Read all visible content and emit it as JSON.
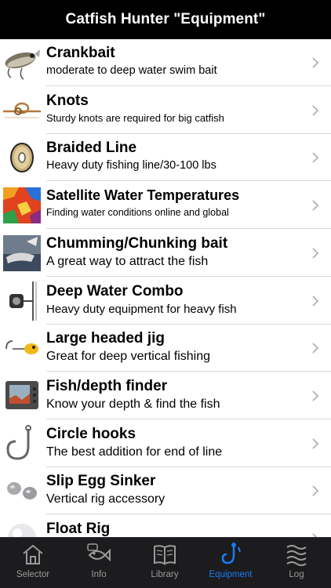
{
  "app": {
    "title": "Catfish Hunter \"Equipment\""
  },
  "list": {
    "items": [
      {
        "title": "Crankbait",
        "subtitle": "moderate to deep water swim bait",
        "icon": "crankbait-thumbnail"
      },
      {
        "title": "Knots",
        "subtitle": "Sturdy knots are required for big catfish",
        "icon": "knot-thumbnail"
      },
      {
        "title": "Braided Line",
        "subtitle": "Heavy duty fishing line/30-100 lbs",
        "icon": "line-spool-thumbnail"
      },
      {
        "title": "Satellite Water Temperatures",
        "subtitle": "Finding water conditions online and global",
        "icon": "temperature-map-thumbnail"
      },
      {
        "title": "Chumming/Chunking bait",
        "subtitle": "A great way to attract the fish",
        "icon": "chum-bait-thumbnail"
      },
      {
        "title": "Deep Water Combo",
        "subtitle": "Heavy duty equipment for heavy fish",
        "icon": "rod-reel-thumbnail"
      },
      {
        "title": "Large headed jig",
        "subtitle": "Great for deep vertical fishing",
        "icon": "jig-thumbnail"
      },
      {
        "title": "Fish/depth finder",
        "subtitle": "Know your depth & find the fish",
        "icon": "depth-finder-thumbnail"
      },
      {
        "title": "Circle hooks",
        "subtitle": "The best addition for end of line",
        "icon": "circle-hook-thumbnail"
      },
      {
        "title": "Slip Egg Sinker",
        "subtitle": "Vertical rig accessory",
        "icon": "egg-sinker-thumbnail"
      },
      {
        "title": "Float Rig",
        "subtitle": "",
        "icon": "float-thumbnail"
      }
    ]
  },
  "tabbar": {
    "active": "Equipment",
    "active_color": "#1a7cf5",
    "inactive_color": "#9a9a9a",
    "tabs": [
      {
        "label": "Selector",
        "icon": "home-icon"
      },
      {
        "label": "Info",
        "icon": "fish-info-icon"
      },
      {
        "label": "Library",
        "icon": "book-icon"
      },
      {
        "label": "Equipment",
        "icon": "hook-icon"
      },
      {
        "label": "Log",
        "icon": "waves-icon"
      }
    ]
  }
}
